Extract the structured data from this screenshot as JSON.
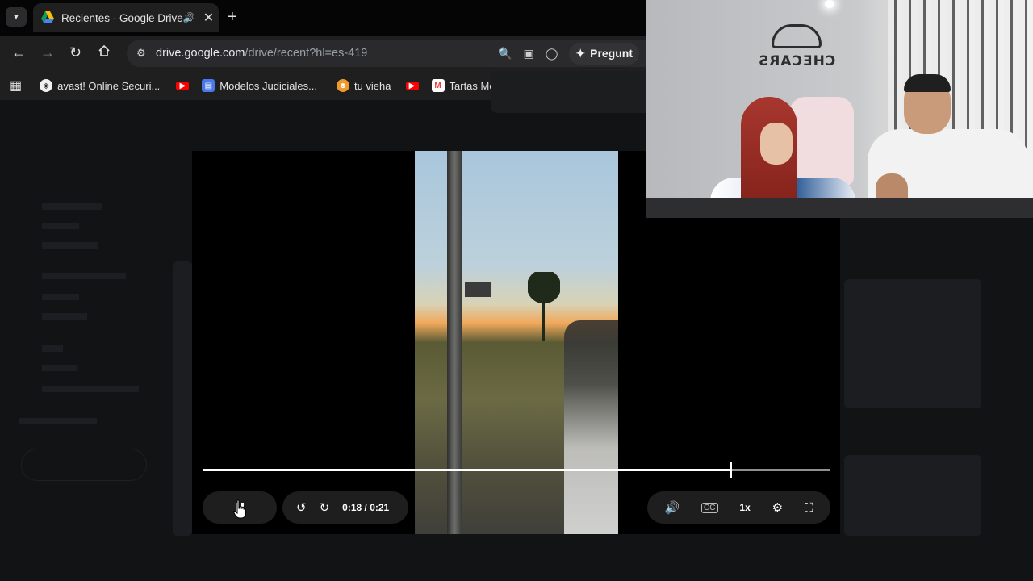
{
  "browser": {
    "tab": {
      "title": "Recientes - Google Drive"
    },
    "url": {
      "host": "drive.google.com",
      "path": "/drive/recent?hl=es-419"
    },
    "ask_label": "Pregunt",
    "bookmarks": [
      {
        "label": "avast! Online Securi...",
        "icon": "avast-icon"
      },
      {
        "label": "",
        "icon": "youtube-icon"
      },
      {
        "label": "Modelos Judiciales...",
        "icon": "doc-icon"
      },
      {
        "label": "tu vieha",
        "icon": "reddit-icon"
      },
      {
        "label": "",
        "icon": "youtube-icon"
      },
      {
        "label": "Tartas Modern",
        "icon": "gmail-icon"
      }
    ]
  },
  "player": {
    "current_time": "0:18",
    "duration": "/ 0:21",
    "progress_fraction": 0.84,
    "speed": "1x"
  },
  "webcam": {
    "logo_text": "CHECARS"
  },
  "colors": {
    "youtube_red": "#ff0000",
    "drive_bg": "#121315",
    "progress_fill": "#ffffff"
  }
}
